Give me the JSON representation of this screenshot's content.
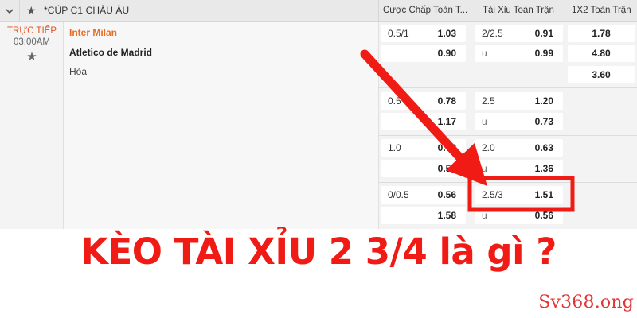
{
  "header": {
    "league": "*CÚP C1 CHÂU ÂU",
    "col_handicap": "Cược Chấp Toàn T...",
    "col_overunder": "Tài Xỉu Toàn Trận",
    "col_1x2": "1X2 Toàn Trận"
  },
  "match": {
    "status": "TRỰC TIẾP",
    "time": "03:00AM",
    "home": "Inter Milan",
    "away": "Atletico de Madrid",
    "draw_label": "Hòa"
  },
  "odds_groups": [
    {
      "handicap_line": "0.5/1",
      "handicap_home": "1.03",
      "handicap_away": "0.90",
      "ou_line": "2/2.5",
      "ou_over": "0.91",
      "ou_under_label": "u",
      "ou_under": "0.99",
      "x12_home": "1.78",
      "x12_away": "4.80",
      "x12_draw": "3.60"
    },
    {
      "handicap_line": "0.5",
      "handicap_home": "0.78",
      "handicap_away": "1.17",
      "ou_line": "2.5",
      "ou_over": "1.20",
      "ou_under_label": "u",
      "ou_under": "0.73"
    },
    {
      "handicap_line": "1.0",
      "handicap_home": "0.78",
      "handicap_away": "0.58",
      "ou_line": "2.0",
      "ou_over": "0.63",
      "ou_under_label": "u",
      "ou_under": "1.36"
    },
    {
      "handicap_line": "0/0.5",
      "handicap_home": "0.56",
      "handicap_away": "1.58",
      "ou_line": "2.5/3",
      "ou_over": "1.51",
      "ou_under_label": "u",
      "ou_under": "0.56"
    }
  ],
  "headline": "KÈO TÀI XỈU 2 3/4 là gì ?",
  "watermark": "Sv368.ong",
  "colors": {
    "accent_red": "#f11b15",
    "live_orange": "#e0521c",
    "home_team_orange": "#ea6a20",
    "header_bg": "#e9e9e9"
  },
  "icons": {
    "collapse": "chevron-down-icon",
    "favorite": "star-icon",
    "annotation": "arrow-icon"
  }
}
